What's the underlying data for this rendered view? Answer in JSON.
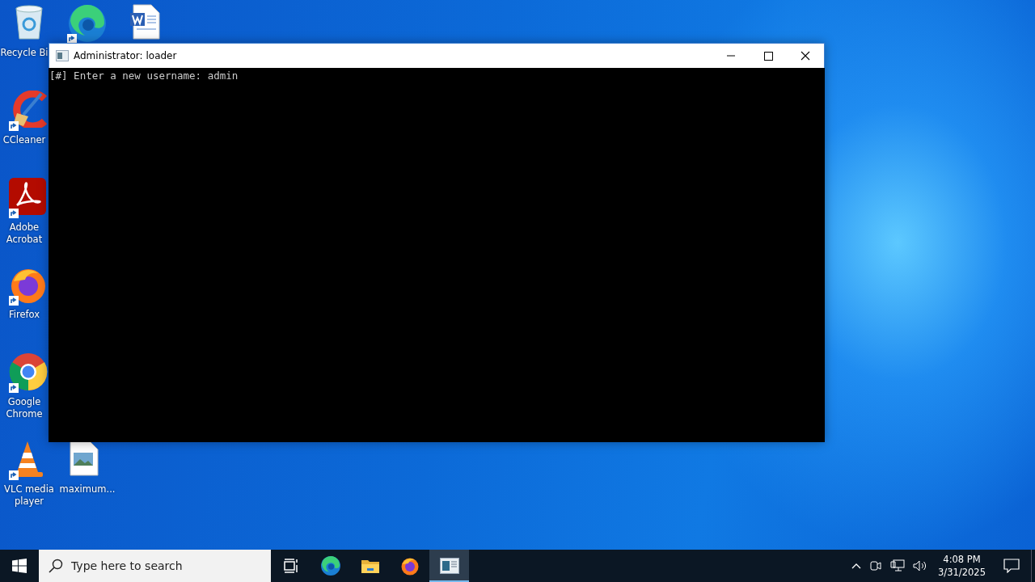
{
  "desktop_icons": [
    {
      "kind": "recycle-bin",
      "label": "Recycle Bi"
    },
    {
      "kind": "ccleaner",
      "label": "CCleaner"
    },
    {
      "kind": "acrobat",
      "label": "Adobe Acrobat"
    },
    {
      "kind": "firefox",
      "label": "Firefox"
    },
    {
      "kind": "chrome",
      "label": "Google Chrome"
    },
    {
      "kind": "vlc",
      "label": "VLC media player"
    },
    {
      "kind": "edge"
    },
    {
      "kind": "image-file",
      "label": "maximum..."
    },
    {
      "kind": "word"
    }
  ],
  "window": {
    "title": "Administrator: loader",
    "console_lines": [
      "[#] Enter a new username: admin"
    ]
  },
  "taskbar": {
    "search": {
      "placeholder": "Type here to search"
    },
    "apps": [
      {
        "kind": "task-view",
        "selected": false
      },
      {
        "kind": "edge",
        "selected": false
      },
      {
        "kind": "explorer",
        "selected": false
      },
      {
        "kind": "firefox",
        "selected": false
      },
      {
        "kind": "console",
        "selected": true
      }
    ],
    "clock": {
      "time": "4:08 PM",
      "date": "3/31/2025"
    }
  }
}
